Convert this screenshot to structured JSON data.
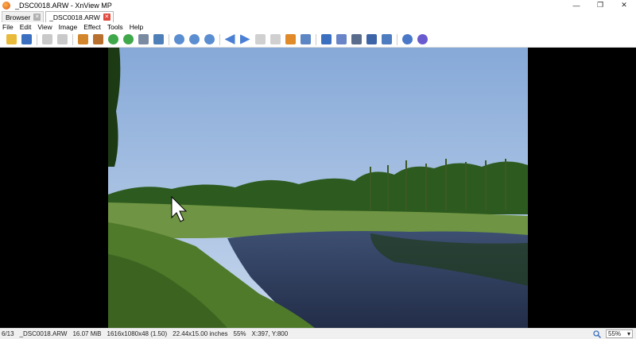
{
  "window": {
    "title": "_DSC0018.ARW - XnView MP",
    "minimize_glyph": "—",
    "restore_glyph": "❐",
    "close_glyph": "✕"
  },
  "tabs": [
    {
      "label": "Browser",
      "close": "✕"
    },
    {
      "label": "_DSC0018.ARW",
      "close": "✕"
    }
  ],
  "menu": [
    "File",
    "Edit",
    "View",
    "Image",
    "Effect",
    "Tools",
    "Help"
  ],
  "toolbar_icons": [
    "open-folder-icon",
    "save-icon",
    "undo-icon",
    "redo-icon",
    "crop-icon",
    "resize-icon",
    "rotate-left-icon",
    "rotate-right-icon",
    "adjust-icon",
    "levels-icon",
    "zoom-in-icon",
    "zoom-fit-icon",
    "zoom-out-icon",
    "previous-icon",
    "next-icon",
    "first-icon",
    "last-icon",
    "slideshow-icon",
    "compare-icon",
    "fullscreen-icon",
    "effects-icon",
    "print-icon",
    "scanner-icon",
    "wallpaper-icon",
    "settings-icon",
    "help-icon"
  ],
  "status": {
    "index": "6/13",
    "filename": "_DSC0018.ARW",
    "filesize": "16.07 MiB",
    "dimensions": "1616x1080x48 (1.50)",
    "print_size": "22.44x15.00 inches",
    "zoom_percent": "55%",
    "coords": "X:397, Y:800",
    "zoom_select": "55%",
    "zoom_arrow": "▾"
  },
  "colors": {
    "sky_top": "#8aaedc",
    "sky_bottom": "#c2d4ea",
    "tree": "#2f5e1f",
    "grass": "#5e8a3a",
    "water": "#2e3f63",
    "accent_close": "#e04a3f"
  }
}
